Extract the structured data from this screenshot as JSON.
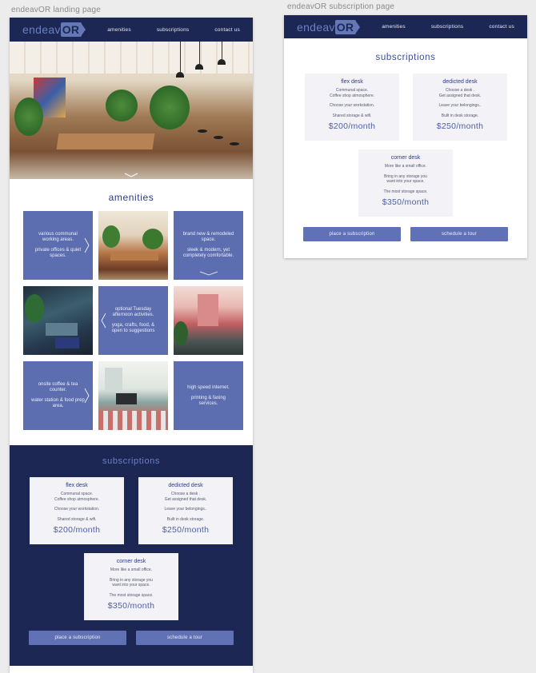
{
  "artboards": {
    "landing_label": "endeavOR landing page",
    "subscription_label": "endeavOR subscription page"
  },
  "brand": {
    "logo_prefix": "endeav",
    "logo_suffix": "OR",
    "colors": {
      "navy": "#1d2754",
      "periwinkle": "#5c6db0",
      "card_bg": "#f3f2f7",
      "title_blue": "#2b3a8a"
    }
  },
  "nav": {
    "items": [
      "amenities",
      "subscriptions",
      "contact us"
    ]
  },
  "amenities": {
    "title": "amenities",
    "tiles": [
      {
        "line1": "various communal working areas.",
        "line2": "private offices & quiet spaces."
      },
      {
        "line1": "brand new & remodeled space.",
        "line2": "sleek & modern, yet completely comfortable."
      },
      {
        "line1": "optional Tuesday afternoon activities.",
        "line2": "yoga, crafts, food, & open to suggestions"
      },
      {
        "line1": "onsite coffee & tea counter.",
        "line2": "water station & food prep area."
      },
      {
        "line1": "high speed internet.",
        "line2": "printing & faxing services."
      }
    ]
  },
  "subscriptions": {
    "title": "subscriptions",
    "plans": [
      {
        "name": "flex desk",
        "lines": [
          "Communal space.",
          "Coffee shop atmosphere."
        ],
        "lines2": [
          "Choose your workstation."
        ],
        "lines3": [
          "Shared storage & wifi."
        ],
        "price": "$200/month"
      },
      {
        "name": "dedicted desk",
        "lines": [
          "Choose a desk .",
          "Get assigned that desk."
        ],
        "lines2": [
          "Leave your belongings.."
        ],
        "lines3": [
          "Built in desk storage."
        ],
        "price": "$250/month"
      },
      {
        "name": "corner desk",
        "lines": [
          "More like a small office."
        ],
        "lines2": [
          "Bring in any storage you",
          "want into your space."
        ],
        "lines3": [
          "The most storage space."
        ],
        "price": "$350/month"
      }
    ],
    "buttons": {
      "place": "place a subscription",
      "tour": "schedule a tour"
    }
  }
}
